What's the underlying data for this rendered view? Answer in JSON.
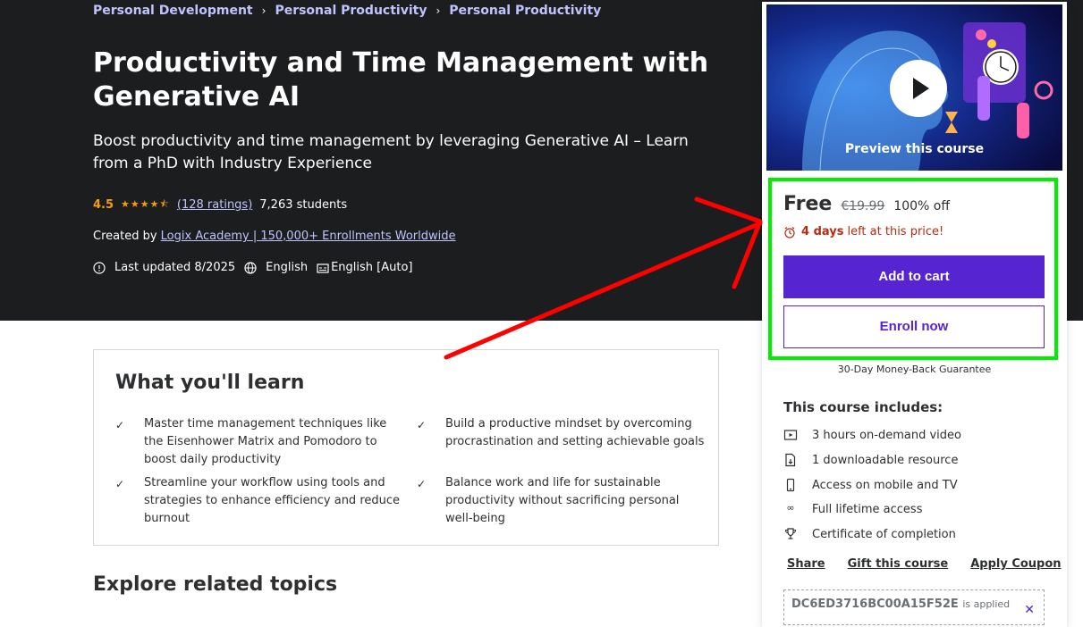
{
  "breadcrumb": [
    "Personal Development",
    "Personal Productivity",
    "Personal Productivity"
  ],
  "course": {
    "title": "Productivity and Time Management with Generative AI",
    "subtitle": "Boost productivity and time management by leveraging Generative AI – Learn from a PhD with Industry Experience",
    "rating": "4.5",
    "stars_fraction": 0.9,
    "ratings_count": "(128 ratings)",
    "students": "7,263 students",
    "created_by_label": "Created by",
    "author": "Logix Academy | 150,000+ Enrollments Worldwide",
    "last_updated": "Last updated 8/2025",
    "language": "English",
    "captions": "English [Auto]"
  },
  "learn": {
    "title": "What you'll learn",
    "items": [
      "Master time management techniques like the Eisenhower Matrix and Pomodoro to boost daily productivity",
      "Build a productive mindset by overcoming procrastination and setting achievable goals",
      "Streamline your workflow using tools and strategies to enhance efficiency and reduce burnout",
      "Balance work and life for sustainable productivity without sacrificing personal well-being"
    ]
  },
  "explore_title": "Explore related topics",
  "sidebar": {
    "preview_label": "Preview this course",
    "price": "Free",
    "original_price": "€19.99",
    "discount": "100% off",
    "timer_bold": "4 days",
    "timer_rest": "left at this price!",
    "add_to_cart": "Add to cart",
    "enroll_now": "Enroll now",
    "guarantee": "30-Day Money-Back Guarantee",
    "includes_title": "This course includes:",
    "includes": [
      {
        "icon": "video-icon",
        "label": "3 hours on-demand video"
      },
      {
        "icon": "file-download-icon",
        "label": "1 downloadable resource"
      },
      {
        "icon": "mobile-icon",
        "label": "Access on mobile and TV"
      },
      {
        "icon": "infinity-icon",
        "label": "Full lifetime access"
      },
      {
        "icon": "trophy-icon",
        "label": "Certificate of completion"
      }
    ],
    "links": [
      "Share",
      "Gift this course",
      "Apply Coupon"
    ],
    "coupon_code": "DC6ED3716BC00A15F52E",
    "coupon_status": "is applied"
  },
  "colors": {
    "hero_bg": "#1c1d1f",
    "link": "#c0c4fc",
    "star": "#f69c08",
    "primary": "#5624d0",
    "timer": "#b32d0f",
    "highlight_box": "#00ee00",
    "annotation_arrow": "#ff0000"
  }
}
